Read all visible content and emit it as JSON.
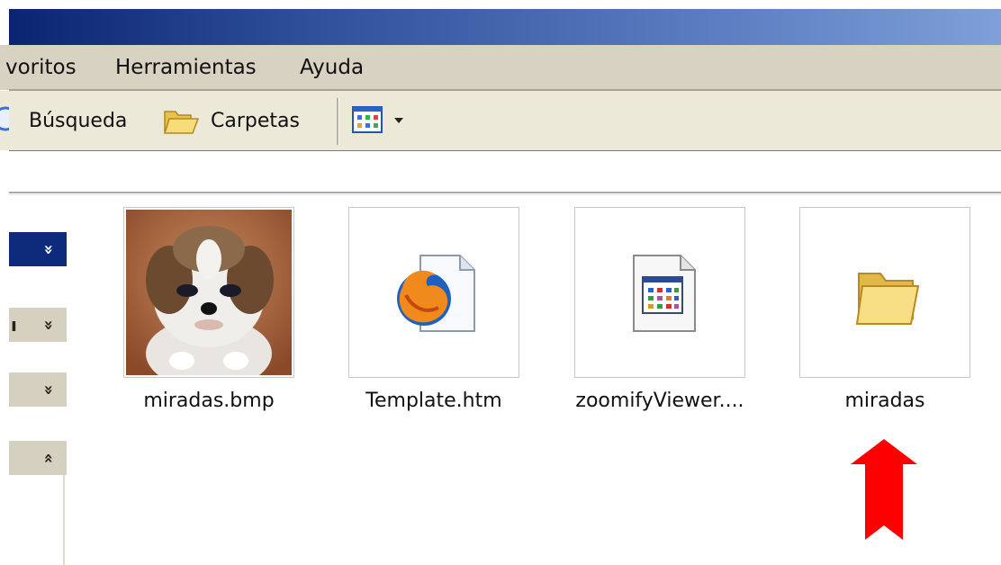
{
  "menu": {
    "favoritos": "voritos",
    "herramientas": "Herramientas",
    "ayuda": "Ayuda"
  },
  "toolbar": {
    "busqueda": "Búsqueda",
    "carpetas": "Carpetas"
  },
  "files": [
    {
      "name": "miradas.bmp",
      "type": "bitmap-thumbnail"
    },
    {
      "name": "Template.htm",
      "type": "firefox-html-icon"
    },
    {
      "name": "zoomifyViewer....",
      "type": "application-icon"
    },
    {
      "name": "miradas",
      "type": "folder-icon"
    }
  ],
  "left_pane": {
    "partial_label": "ı"
  },
  "annotation": {
    "arrow_color": "#ff0000",
    "arrow_icon": "red-up-arrow-icon"
  },
  "colors": {
    "titlebar_start": "#0a2471",
    "titlebar_end": "#7e9fd8",
    "toolbar_bg": "#ece9d8",
    "panel_header": "#0e2a7a"
  }
}
